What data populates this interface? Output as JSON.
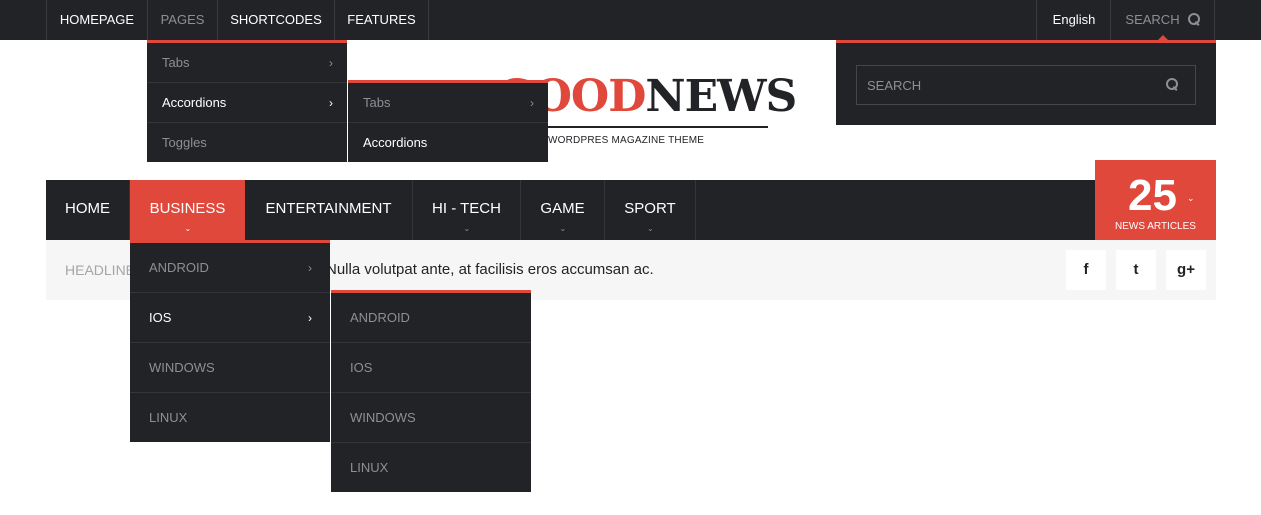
{
  "topbar": {
    "items": [
      {
        "label": "HOMEPAGE"
      },
      {
        "label": "PAGES"
      },
      {
        "label": "SHORTCODES"
      },
      {
        "label": "FEATURES"
      }
    ],
    "language": "English",
    "search_label": "SEARCH"
  },
  "pages_menu": {
    "items": [
      {
        "label": "Tabs"
      },
      {
        "label": "Accordions"
      },
      {
        "label": "Toggles"
      }
    ],
    "submenu": [
      {
        "label": "Tabs"
      },
      {
        "label": "Accordions"
      }
    ]
  },
  "logo": {
    "part1": "GOOD",
    "part2": "NEWS",
    "tagline": "WORDPRES MAGAZINE THEME"
  },
  "search": {
    "placeholder": "SEARCH"
  },
  "nav": {
    "items": [
      {
        "label": "HOME"
      },
      {
        "label": "BUSINESS"
      },
      {
        "label": "ENTERTAINMENT"
      },
      {
        "label": "HI - TECH"
      },
      {
        "label": "GAME"
      },
      {
        "label": "SPORT"
      }
    ]
  },
  "counter": {
    "value": "25",
    "label": "NEWS ARTICLES"
  },
  "headline": {
    "label": "HEADLINES",
    "text": "Nulla volutpat ante, at facilisis eros accumsan ac."
  },
  "social": {
    "facebook": "f",
    "twitter": "t",
    "googleplus": "g+"
  },
  "business_menu": {
    "items": [
      {
        "label": "ANDROID"
      },
      {
        "label": "IOS"
      },
      {
        "label": "WINDOWS"
      },
      {
        "label": "LINUX"
      }
    ],
    "submenu": [
      {
        "label": "ANDROID"
      },
      {
        "label": "IOS"
      },
      {
        "label": "WINDOWS"
      },
      {
        "label": "LINUX"
      }
    ]
  },
  "colors": {
    "accent": "#e0483b",
    "dark": "#222327"
  }
}
